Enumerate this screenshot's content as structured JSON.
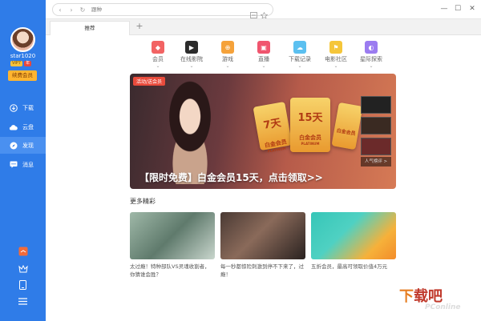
{
  "user": {
    "name": "star1020",
    "vip_badge": "VIP7",
    "small_badge": "年",
    "renew_label": "续费会员"
  },
  "nav": [
    {
      "label": "下载",
      "icon": "download-icon"
    },
    {
      "label": "云盘",
      "icon": "cloud-icon"
    },
    {
      "label": "发现",
      "icon": "compass-icon",
      "active": true
    },
    {
      "label": "消息",
      "icon": "chat-icon"
    }
  ],
  "address": {
    "placeholder": "跟种"
  },
  "tabs": [
    {
      "label": "推荐"
    }
  ],
  "categories": [
    {
      "label": "会员",
      "color": "#f26363",
      "icon": "diamond-icon"
    },
    {
      "label": "在线影院",
      "color": "#2b2b2b",
      "icon": "film-icon"
    },
    {
      "label": "游戏",
      "color": "#f5a23a",
      "icon": "gamepad-icon"
    },
    {
      "label": "直播",
      "color": "#f0556e",
      "icon": "tv-icon"
    },
    {
      "label": "下载记录",
      "color": "#5bc0f0",
      "icon": "cloud-download-icon"
    },
    {
      "label": "电影社区",
      "color": "#f5c63a",
      "icon": "flag-icon"
    },
    {
      "label": "星际探索",
      "color": "#9b7cf0",
      "icon": "planet-icon"
    }
  ],
  "banner": {
    "tag": "活动/送会员",
    "cards": [
      {
        "value": "7天",
        "sub": "白金会员",
        "sub2": "PLATINUM"
      },
      {
        "value": "15天",
        "sub": "白金会员",
        "sub2": "PLATINUM"
      },
      {
        "value": "",
        "sub": "白金会员",
        "sub2": ""
      }
    ],
    "headline": "【限时免费】白金会员15天，点击领取>>",
    "thumb_label": "人气榜评 >"
  },
  "more": {
    "title": "更多精彩",
    "items": [
      {
        "title": "太过瘾！特种部队VS灵魂收割者，你猜谁会胜？"
      },
      {
        "title": "每一秒都惊险刺激到停不下来了，过瘾！"
      },
      {
        "title": "五折会员，最高可领取价值4万元"
      }
    ]
  },
  "watermark": {
    "line1": "下载吧",
    "line2": "PConline",
    "part_a": "下",
    "part_b": "载",
    "part_c": "吧"
  }
}
